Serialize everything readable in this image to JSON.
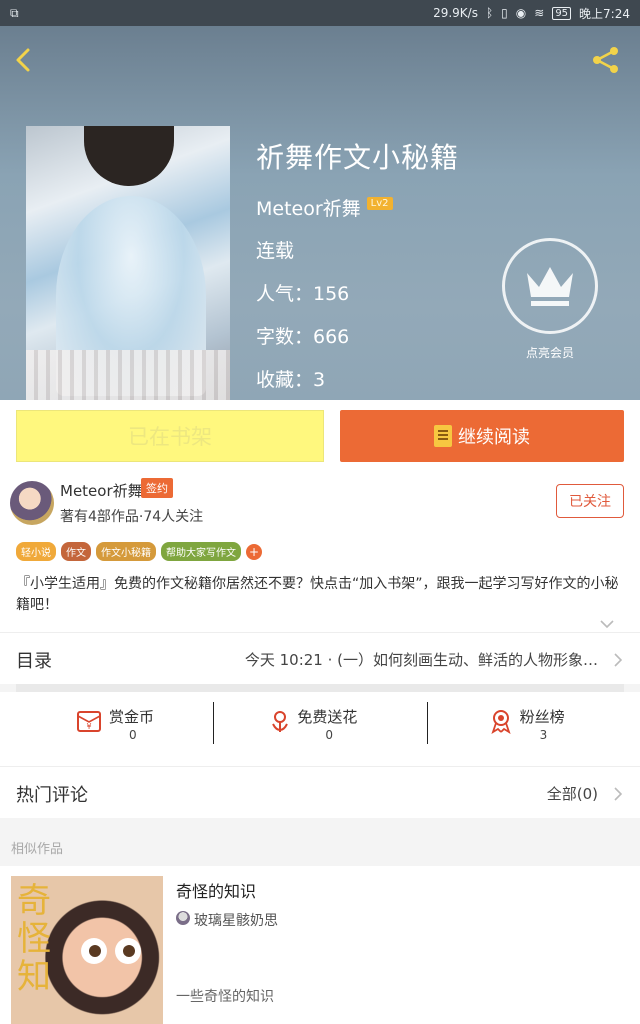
{
  "status_bar": {
    "speed": "29.9K/s",
    "battery": "95",
    "time": "晚上7:24"
  },
  "book": {
    "title": "祈舞作文小秘籍",
    "author": "Meteor祈舞",
    "level": "Lv2",
    "status": "连载",
    "popularity": "人气：156",
    "word_count": "字数：666",
    "favorites": "收藏：3",
    "vip_label": "点亮会员"
  },
  "actions": {
    "shelf_label": "已在书架",
    "read_label": "继续阅读"
  },
  "author_card": {
    "name": "Meteor祈舞",
    "badge": "签约",
    "works_follow": "著有4部作品·74人关注",
    "follow_label": "已关注"
  },
  "tags": [
    {
      "label": "轻小说",
      "color": "#f0a93a"
    },
    {
      "label": "作文",
      "color": "#c4663b"
    },
    {
      "label": "作文小秘籍",
      "color": "#d59a3b"
    },
    {
      "label": "帮助大家写作文",
      "color": "#7fa63f"
    }
  ],
  "tag_add": "+",
  "description": "『小学生适用』免费的作文秘籍你居然还不要？快点击“加入书架”，跟我一起学习写好作文的小秘籍吧！",
  "toc": {
    "label": "目录",
    "latest": "今天 10:21 · (一）如何刻画生动、鲜活的人物形象…"
  },
  "stats": [
    {
      "name": "赏金币",
      "value": "0",
      "icon": "coin-envelope-icon"
    },
    {
      "name": "免费送花",
      "value": "0",
      "icon": "flower-icon"
    },
    {
      "name": "粉丝榜",
      "value": "3",
      "icon": "medal-icon"
    }
  ],
  "comments": {
    "label": "热门评论",
    "all": "全部(0)"
  },
  "similar": {
    "section_label": "相似作品",
    "title": "奇怪的知识",
    "author": "玻璃星骸奶思",
    "desc": "一些奇怪的知识",
    "cover_text": "奇怪知"
  },
  "colors": {
    "accent": "#ec6a35",
    "shelf_bg": "#fff87e",
    "icon_red": "#d9442c"
  }
}
